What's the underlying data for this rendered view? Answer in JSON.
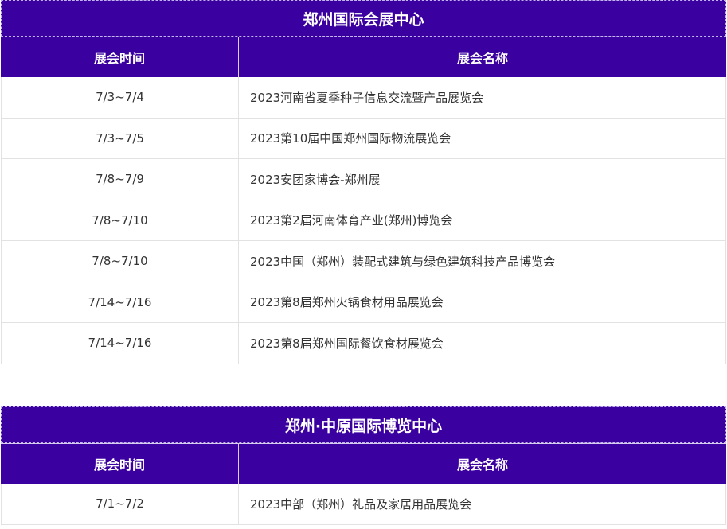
{
  "venues": [
    {
      "title": "郑州国际会展中心",
      "headers": {
        "date": "展会时间",
        "name": "展会名称"
      },
      "rows": [
        {
          "date": "7/3~7/4",
          "name": "2023河南省夏季种子信息交流暨产品展览会"
        },
        {
          "date": "7/3~7/5",
          "name": "2023第10届中国郑州国际物流展览会"
        },
        {
          "date": "7/8~7/9",
          "name": "2023安团家博会-郑州展"
        },
        {
          "date": "7/8~7/10",
          "name": "2023第2届河南体育产业(郑州)博览会"
        },
        {
          "date": "7/8~7/10",
          "name": "2023中国（郑州）装配式建筑与绿色建筑科技产品博览会"
        },
        {
          "date": "7/14~7/16",
          "name": "2023第8届郑州火锅食材用品展览会"
        },
        {
          "date": "7/14~7/16",
          "name": "2023第8届郑州国际餐饮食材展览会"
        }
      ]
    },
    {
      "title": "郑州·中原国际博览中心",
      "headers": {
        "date": "展会时间",
        "name": "展会名称"
      },
      "rows": [
        {
          "date": "7/1~7/2",
          "name": "2023中部（郑州）礼品及家居用品展览会"
        }
      ]
    }
  ],
  "colors": {
    "header_bg": "#3b00a0",
    "header_text": "#ffffff",
    "body_text": "#333333",
    "grid": "#e2e2e2"
  }
}
